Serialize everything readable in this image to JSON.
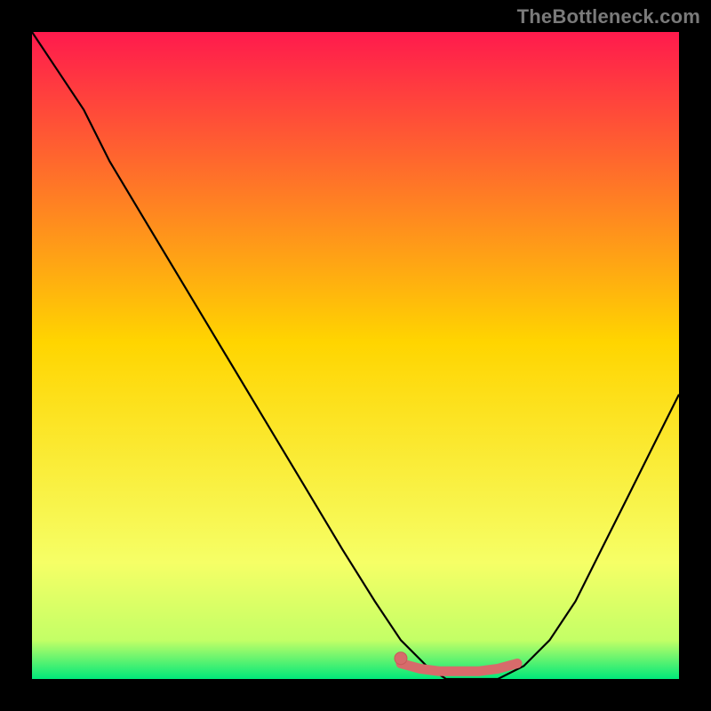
{
  "watermark": "TheBottleneck.com",
  "colors": {
    "frame": "#000000",
    "grad_top": "#ff1a4d",
    "grad_mid": "#ffd500",
    "grad_low": "#f6ff66",
    "grad_bottom": "#00e87a",
    "curve": "#000000",
    "dot_fill": "#d76b6b",
    "dot_stroke": "#c85a5a"
  },
  "layout": {
    "outer": 800,
    "frame": 36,
    "inner": 728
  },
  "chart_data": {
    "type": "line",
    "title": "",
    "xlabel": "",
    "ylabel": "",
    "xlim": [
      0,
      100
    ],
    "ylim": [
      0,
      100
    ],
    "grid": false,
    "series": [
      {
        "name": "bottleneck-curve",
        "x": [
          0,
          4,
          8,
          12,
          18,
          24,
          30,
          36,
          42,
          48,
          53,
          57,
          61,
          64,
          68,
          72,
          76,
          80,
          84,
          88,
          92,
          96,
          100
        ],
        "y": [
          100,
          94,
          88,
          80,
          70,
          60,
          50,
          40,
          30,
          20,
          12,
          6,
          2,
          0,
          0,
          0,
          2,
          6,
          12,
          20,
          28,
          36,
          44
        ]
      }
    ],
    "annotations": {
      "optimal_segment": {
        "x": [
          57,
          60,
          63,
          66,
          69,
          72,
          75
        ],
        "y": [
          2.4,
          1.6,
          1.2,
          1.2,
          1.2,
          1.6,
          2.4
        ]
      },
      "marker": {
        "x": 57,
        "y": 3.2
      }
    }
  }
}
